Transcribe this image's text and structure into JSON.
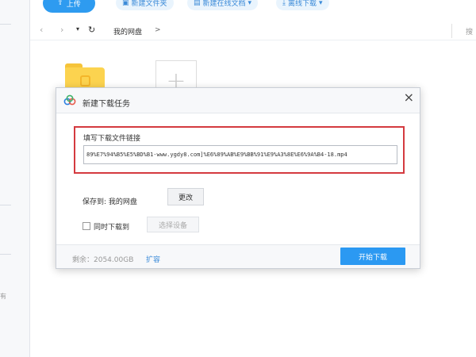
{
  "toolbar": {
    "upload_label": "上传",
    "new_folder_label": "新建文件夹",
    "new_online_doc_label": "新建在线文档",
    "offline_download_label": "离线下载"
  },
  "address": {
    "breadcrumb": "我的网盘",
    "breadcrumb_sep": ">",
    "search_label": "搜"
  },
  "sidebar": {
    "partial_text": "有"
  },
  "dialog": {
    "title": "新建下载任务",
    "close_symbol": "×",
    "link_label": "填写下载文件链接",
    "link_value": "89%E7%94%B5%E5%BD%B1-www.ygdy8.com]%E6%89%AB%E9%BB%91%E9%A3%8E%E6%9A%B4-18.mp4",
    "save_to_label": "保存到: 我的网盘",
    "change_button": "更改",
    "sync_label": "同时下载到",
    "select_device_button": "选择设备",
    "space_remaining": "剩余：2054.00GB",
    "expand_label": "扩容",
    "start_button": "开始下载"
  },
  "colors": {
    "accent": "#2b99f2",
    "highlight_border": "#d43a3f",
    "folder": "#fcd34f"
  }
}
